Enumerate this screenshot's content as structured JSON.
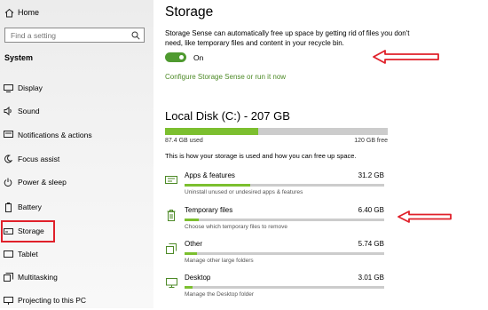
{
  "sidebar": {
    "home_label": "Home",
    "search_placeholder": "Find a setting",
    "section_title": "System",
    "items": [
      {
        "label": "Display",
        "icon": "display-icon"
      },
      {
        "label": "Sound",
        "icon": "sound-icon"
      },
      {
        "label": "Notifications & actions",
        "icon": "notifications-icon"
      },
      {
        "label": "Focus assist",
        "icon": "focus-assist-icon"
      },
      {
        "label": "Power & sleep",
        "icon": "power-icon"
      },
      {
        "label": "Battery",
        "icon": "battery-icon"
      },
      {
        "label": "Storage",
        "icon": "storage-icon"
      },
      {
        "label": "Tablet",
        "icon": "tablet-icon"
      },
      {
        "label": "Multitasking",
        "icon": "multitasking-icon"
      },
      {
        "label": "Projecting to this PC",
        "icon": "projecting-icon"
      }
    ],
    "selected": "Storage"
  },
  "main": {
    "title": "Storage",
    "description": "Storage Sense can automatically free up space by getting rid of files you don't need, like temporary files and content in your recycle bin.",
    "toggle_state": "On",
    "toggle_on": true,
    "configure_link": "Configure Storage Sense or run it now",
    "disk": {
      "title": "Local Disk (C:) - 207 GB",
      "used_label": "87.4 GB used",
      "free_label": "120 GB free",
      "used_fraction": 0.42
    },
    "howto": "This is how your storage is used and how you can free up space.",
    "categories": [
      {
        "name": "Apps & features",
        "size": "31.2 GB",
        "sub": "Uninstall unused or undesired apps & features",
        "fraction": 0.33,
        "icon": "apps-icon"
      },
      {
        "name": "Temporary files",
        "size": "6.40 GB",
        "sub": "Choose which temporary files to remove",
        "fraction": 0.07,
        "icon": "trash-icon"
      },
      {
        "name": "Other",
        "size": "5.74 GB",
        "sub": "Manage other large folders",
        "fraction": 0.06,
        "icon": "other-icon"
      },
      {
        "name": "Desktop",
        "size": "3.01 GB",
        "sub": "Manage the Desktop folder",
        "fraction": 0.04,
        "icon": "desktop-icon"
      }
    ]
  },
  "colors": {
    "accent_green": "#7cbf2f",
    "toggle_green": "#4f9a30",
    "link_green": "#4d8a27",
    "highlight_red": "#e0202a"
  }
}
